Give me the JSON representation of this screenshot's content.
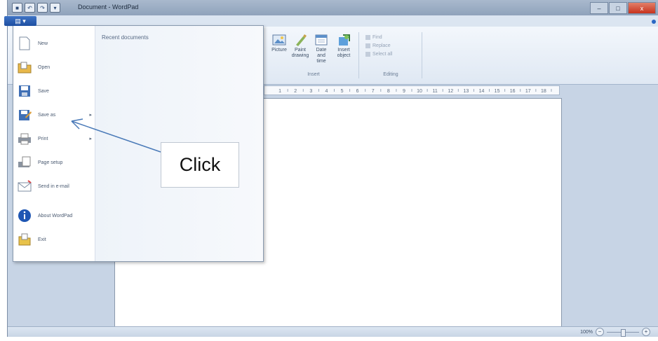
{
  "window": {
    "title": "Document - WordPad",
    "close_label": "x"
  },
  "app_button": {
    "label": ""
  },
  "ribbon": {
    "groups": [
      {
        "name": "Insert",
        "buttons": [
          {
            "label": "Picture",
            "icon": "picture-icon"
          },
          {
            "label": "Paint drawing",
            "icon": "paint-drawing-icon"
          },
          {
            "label": "Date and time",
            "icon": "date-time-icon"
          },
          {
            "label": "Insert object",
            "icon": "insert-object-icon"
          }
        ]
      },
      {
        "name": "Editing",
        "items": [
          "Find",
          "Replace",
          "Select all"
        ]
      }
    ]
  },
  "app_menu": {
    "items": [
      {
        "label": "New",
        "icon": "new-document-icon",
        "has_submenu": false
      },
      {
        "label": "Open",
        "icon": "open-folder-icon",
        "has_submenu": false
      },
      {
        "label": "Save",
        "icon": "save-icon",
        "has_submenu": false
      },
      {
        "label": "Save as",
        "icon": "save-as-icon",
        "has_submenu": true
      },
      {
        "label": "Print",
        "icon": "print-icon",
        "has_submenu": true
      },
      {
        "label": "Page setup",
        "icon": "page-setup-icon",
        "has_submenu": false
      },
      {
        "label": "Send in e-mail",
        "icon": "email-icon",
        "has_submenu": false
      },
      {
        "label": "About WordPad",
        "icon": "info-icon",
        "has_submenu": false
      },
      {
        "label": "Exit",
        "icon": "exit-icon",
        "has_submenu": false
      }
    ],
    "recent_title": "Recent documents"
  },
  "ruler": {
    "marks": [
      "1",
      "2",
      "3",
      "4",
      "5",
      "6",
      "7",
      "8",
      "9",
      "10",
      "11",
      "12",
      "13",
      "14",
      "15",
      "16",
      "17",
      "18"
    ]
  },
  "statusbar": {
    "zoom_text": "100%",
    "zoom_out": "−",
    "zoom_in": "+"
  },
  "annotation": {
    "text": "Click",
    "arrow_color": "#4a7ab8"
  },
  "colors": {
    "accent": "#1d4ea1",
    "workspace": "#c7d4e5"
  }
}
